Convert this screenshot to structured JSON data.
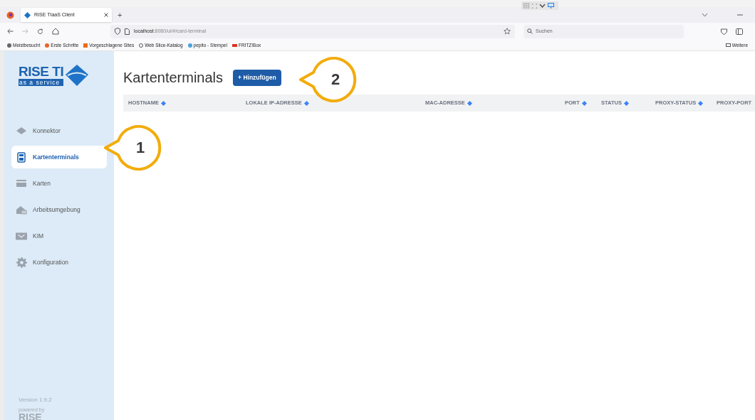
{
  "browser": {
    "tab_title": "RISE TIaaS Client",
    "new_tab": "+",
    "address": {
      "host": "localhost",
      "path": ":8080/ui/#/card-terminal"
    },
    "search": {
      "placeholder": "Suchen"
    },
    "bookmarks": [
      "Meistbesucht",
      "Erste Schritte",
      "Vorgeschlagene Sites",
      "Web Slice-Katalog",
      "pepito - Stempel",
      "FRITZ!Box"
    ],
    "other_bookmarks": "Weitere"
  },
  "sidebar": {
    "logo": {
      "title": "RISE TI",
      "subtitle": "as a service"
    },
    "items": [
      {
        "label": "Konnektor",
        "kind": "connector",
        "selected": false
      },
      {
        "label": "Kartenterminals",
        "kind": "terminal",
        "selected": true
      },
      {
        "label": "Karten",
        "kind": "card",
        "selected": false
      },
      {
        "label": "Arbeitsumgebung",
        "kind": "workplace",
        "selected": false
      },
      {
        "label": "KIM",
        "kind": "mail",
        "selected": false
      },
      {
        "label": "Konfiguration",
        "kind": "gear",
        "selected": false
      }
    ],
    "version": "Version 1.9.2",
    "powered_by": "powered by",
    "brand": "RISE"
  },
  "page": {
    "title": "Kartenterminals",
    "add_button": "+ Hinzufügen",
    "columns": [
      "HOSTNAME",
      "LOKALE IP-ADRESSE",
      "MAC-ADRESSE",
      "PORT",
      "STATUS",
      "PROXY-STATUS",
      "PROXY-PORT"
    ]
  },
  "callouts": [
    "1",
    "2"
  ]
}
